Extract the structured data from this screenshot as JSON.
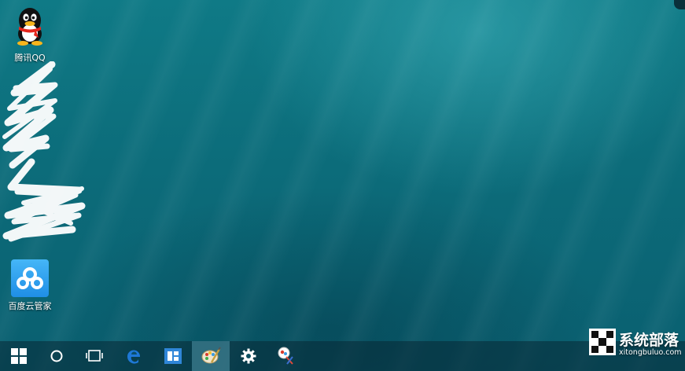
{
  "desktop": {
    "icons": [
      {
        "label": "腾讯QQ",
        "icon": "qq-penguin-icon"
      },
      {
        "label": "百度云管家",
        "icon": "baidu-cloud-icon"
      }
    ],
    "redacted_icons": "scribble-redaction"
  },
  "taskbar": {
    "buttons": [
      {
        "name": "start",
        "icon": "windows-logo-icon"
      },
      {
        "name": "cortana",
        "icon": "cortana-circle-icon"
      },
      {
        "name": "task-view",
        "icon": "task-view-icon"
      },
      {
        "name": "edge",
        "icon": "edge-browser-icon"
      },
      {
        "name": "app",
        "icon": "blue-app-icon"
      },
      {
        "name": "paint",
        "icon": "paint-palette-icon",
        "active": true
      },
      {
        "name": "settings",
        "icon": "gear-icon"
      },
      {
        "name": "snipping",
        "icon": "snipping-tool-icon"
      }
    ]
  },
  "watermark": {
    "title": "系统部落",
    "url": "xitongbuluo.com"
  },
  "colors": {
    "wallpaper": "#0c6c7a",
    "taskbar": "#0a3a48",
    "active_button": "#4f8fa0",
    "edge_blue": "#1e78d6",
    "baidu_blue": "#2a9bef"
  }
}
